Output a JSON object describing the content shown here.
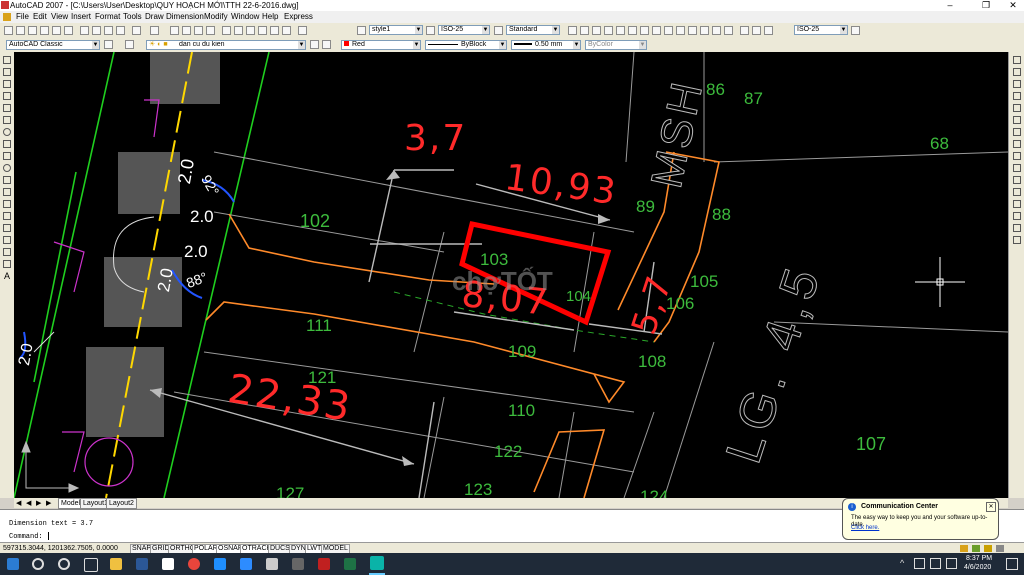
{
  "window": {
    "title": "AutoCAD 2007 - [C:\\Users\\User\\Desktop\\QUY HOẠCH MỚI\\TTH 22-6-2016.dwg]",
    "minimize": "–",
    "maximize": "❐",
    "close": "✕"
  },
  "menu": [
    "File",
    "Edit",
    "View",
    "Insert",
    "Format",
    "Tools",
    "Draw",
    "Dimension",
    "Modify",
    "Window",
    "Help",
    "Express"
  ],
  "toolbar1": {
    "text_style": "style1",
    "dim_style": "ISO-25",
    "table_style": "Standard",
    "ml_style": "ISO-25"
  },
  "toolbar2": {
    "workspace": "AutoCAD Classic",
    "layer": "dan cu du kien",
    "color": "Red",
    "linetype": "ByBlock",
    "lineweight": "0.50 mm",
    "plotstyle": "ByColor"
  },
  "drawing": {
    "dims": {
      "d1": "3,7",
      "d2": "10,93",
      "d3": "8,07",
      "d4": "5,7",
      "d5": "22,33"
    },
    "parcels": {
      "p86": "86",
      "p87": "87",
      "p68": "68",
      "p89": "89",
      "p88": "88",
      "p102": "102",
      "p103": "103",
      "p104": "104",
      "p105": "105",
      "p106": "106",
      "p111": "111",
      "p109": "109",
      "p108": "108",
      "p121": "121",
      "p110": "110",
      "p122": "122",
      "p107": "107",
      "p127": "127",
      "p123": "123",
      "p124": "124"
    },
    "small": {
      "a1": "2.0",
      "a2": "2.0",
      "a3": "2.0",
      "a4": "2.0",
      "a5": "2.0",
      "ang1": "92°",
      "ang2": "88°"
    },
    "road_text": "LG. 4,5",
    "msh_text": "MSH",
    "watermark": "chợTỐT"
  },
  "tabs": [
    "Model",
    "Layout1",
    "Layout2"
  ],
  "command": {
    "line1": "Dimension text = 3.7",
    "line2": "Command:"
  },
  "status": {
    "coords": "597315.3044, 1201362.7505, 0.0000",
    "buttons": [
      "SNAP",
      "GRID",
      "ORTHO",
      "POLAR",
      "OSNAP",
      "OTRACK",
      "DUCS",
      "DYN",
      "LWT",
      "MODEL"
    ]
  },
  "notification": {
    "title": "Communication Center",
    "body": "The easy way to keep you and your software up-to-date.",
    "link": "Click here.",
    "close": "✕"
  },
  "taskbar": {
    "time": "8:37 PM",
    "date": "4/6/2020"
  },
  "colors": {
    "dim": "#ff2a2a",
    "parcel_text": "#3dbb3d",
    "road_green": "#1fcf1f",
    "orange": "#ff8a2a",
    "grey": "#a0a0a0"
  }
}
